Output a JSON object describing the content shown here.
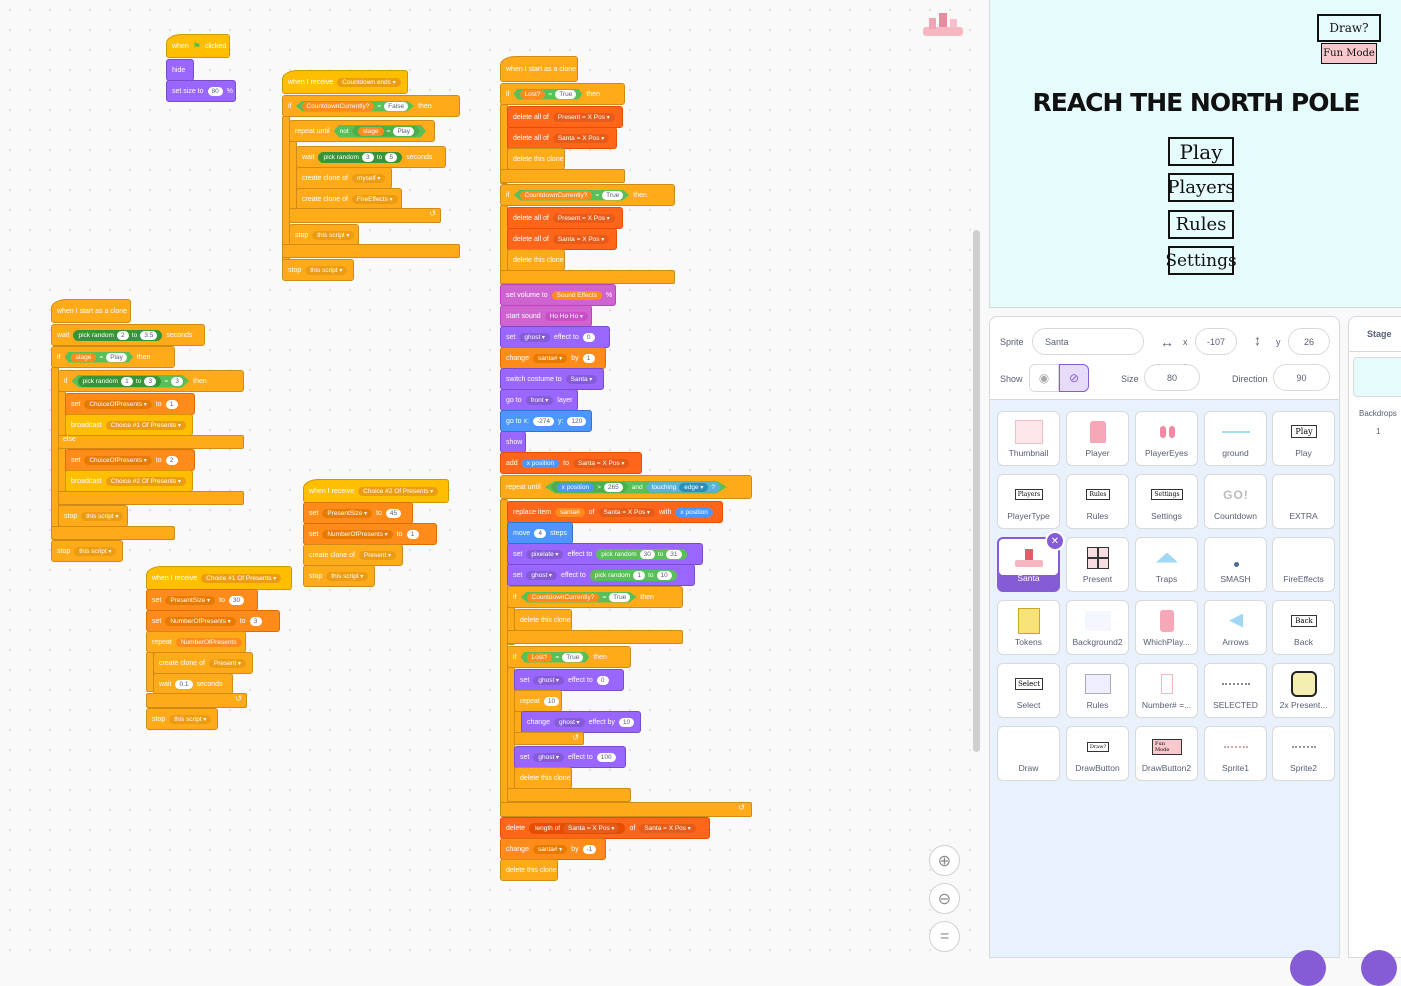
{
  "scripts": {
    "s1": {
      "hat_when": "when",
      "hat_clicked": "clicked",
      "hide": "hide",
      "set_size": "set size to",
      "size_val": "80",
      "pct": "%"
    },
    "s2": {
      "hat": "when I receive",
      "msg": "Countdown ends",
      "if": "if",
      "var": "CountdownCurrently?",
      "eq": "=",
      "val": "False",
      "then": "then",
      "repeat_until": "repeat until",
      "not": "not",
      "stage": "stage",
      "play": "Play",
      "wait": "wait",
      "pick_random": "pick random",
      "r1": "3",
      "to": "to",
      "r2": "5",
      "seconds": "seconds",
      "create_clone": "create clone of",
      "myself": "myself",
      "fire": "FireEffects",
      "stop": "stop",
      "this_script": "this script"
    },
    "s3": {
      "hat": "when I start as a clone",
      "wait": "wait",
      "pick_random": "pick random",
      "r1": "2",
      "to": "to",
      "r2": "3.5",
      "seconds": "seconds",
      "if": "if",
      "stage": "stage",
      "eq": "=",
      "play": "Play",
      "then": "then",
      "r3": "1",
      "r4": "3",
      "r5": "3",
      "set": "set",
      "choice_var": "ChoiceOfPresents",
      "c1": "1",
      "c2": "2",
      "broadcast": "broadcast",
      "b1": "Choice #1 Of Presents",
      "b2": "Choice #2 Of Presents",
      "else": "else",
      "stop": "stop",
      "this_script": "this script"
    },
    "s4": {
      "hat": "when I receive",
      "msg": "Choice #1 Of Presents",
      "set": "set",
      "present_size": "PresentSize",
      "to": "to",
      "v1": "30",
      "num_presents": "NumberOfPresents",
      "v2": "3",
      "repeat": "repeat",
      "create_clone": "create clone of",
      "present": "Present",
      "wait": "wait",
      "wv": "0.1",
      "seconds": "seconds",
      "stop": "stop",
      "this_script": "this script"
    },
    "s5": {
      "hat": "when I receive",
      "msg": "Choice #2 Of Presents",
      "set": "set",
      "present_size": "PresentSize",
      "to": "to",
      "v1": "45",
      "num_presents": "NumberOfPresents",
      "v2": "1",
      "create_clone": "create clone of",
      "present": "Present",
      "stop": "stop",
      "this_script": "this script"
    },
    "s6": {
      "hat": "when I start as a clone",
      "if": "if",
      "lost": "Lost?",
      "eq": "=",
      "true": "True",
      "then": "then",
      "delete_all": "delete all of",
      "present_list": "Present = X Pos",
      "santa_list": "Santa = X Pos",
      "delete_clone": "delete this clone",
      "countdown": "CountdownCurrently?",
      "set_volume": "set volume to",
      "sound_effects": "Sound Effects",
      "pct": "%",
      "start_sound": "start sound",
      "hohoho": "Ho Ho Ho",
      "set": "set",
      "ghost": "ghost",
      "effect_to": "effect to",
      "g0": "0",
      "change": "change",
      "santa_num": "santa#",
      "by": "by",
      "one": "1",
      "switch_costume": "switch costume to",
      "santa": "Santa",
      "go_to": "go to",
      "front": "front",
      "layer": "layer",
      "go_to_xy": "go to x:",
      "x": "-274",
      "y_lbl": "y:",
      "y": "120",
      "show": "show",
      "add": "add",
      "x_position": "x position",
      "to": "to",
      "repeat_until": "repeat until",
      "gt": ">",
      "x265": "265",
      "and": "and",
      "touching": "touching",
      "edge": "edge",
      "q": "?",
      "replace_item": "replace item",
      "of": "of",
      "with": "with",
      "move": "move",
      "steps_val": "4",
      "steps": "steps",
      "pixelate": "pixelate",
      "pick_random": "pick random",
      "p1": "30",
      "p2": "31",
      "g1": "1",
      "g10": "10",
      "repeat": "repeat",
      "rep10": "10",
      "change_ghost_by": "effect by",
      "g100": "100",
      "delete": "delete",
      "length_of": "length of",
      "neg1": "-1"
    }
  },
  "zoom": {
    "in": "+",
    "out": "−",
    "reset": "="
  },
  "stage": {
    "title": "REACH THE NORTH POLE",
    "draw": "Draw?",
    "fun_mode": "Fun Mode",
    "play": "Play",
    "players": "Players",
    "rules": "Rules",
    "settings": "Settings"
  },
  "sprite_info": {
    "sprite_label": "Sprite",
    "sprite_name": "Santa",
    "x_label": "x",
    "x": "-107",
    "y_label": "y",
    "y": "26",
    "show_label": "Show",
    "size_label": "Size",
    "size": "80",
    "direction_label": "Direction",
    "direction": "90"
  },
  "sprites": [
    {
      "name": "Thumbnail"
    },
    {
      "name": "Player"
    },
    {
      "name": "PlayerEyes"
    },
    {
      "name": "ground"
    },
    {
      "name": "Play"
    },
    {
      "name": "PlayerType"
    },
    {
      "name": "Rules"
    },
    {
      "name": "Settings"
    },
    {
      "name": "Countdown"
    },
    {
      "name": "EXTRA"
    },
    {
      "name": "Santa"
    },
    {
      "name": "Present"
    },
    {
      "name": "Traps"
    },
    {
      "name": "SMASH"
    },
    {
      "name": "FireEffects"
    },
    {
      "name": "Tokens"
    },
    {
      "name": "Background2"
    },
    {
      "name": "WhichPlay..."
    },
    {
      "name": "Arrows"
    },
    {
      "name": "Back"
    },
    {
      "name": "Select"
    },
    {
      "name": "Rules"
    },
    {
      "name": "Number# =..."
    },
    {
      "name": "SELECTED"
    },
    {
      "name": "2x Present..."
    },
    {
      "name": "Draw"
    },
    {
      "name": "DrawButton"
    },
    {
      "name": "DrawButton2"
    },
    {
      "name": "Sprite1"
    },
    {
      "name": "Sprite2"
    }
  ],
  "thumb_text": {
    "play": "Play",
    "players": "Players",
    "rules": "Rules",
    "settings": "Settings",
    "go": "GO!",
    "back": "Back",
    "select": "Select",
    "draw": "Draw?",
    "fun": "Fun Mode"
  },
  "stage_panel": {
    "label": "Stage",
    "backdrops_label": "Backdrops",
    "backdrops": "1"
  },
  "colors": {
    "events": "#ffbf00",
    "control": "#ffab19",
    "looks": "#9966ff",
    "sound": "#cf63cf",
    "motion": "#4c97ff",
    "operators": "#59c059",
    "variables": "#ff8c1a",
    "lists": "#ff661a",
    "accent": "#855cd6"
  }
}
